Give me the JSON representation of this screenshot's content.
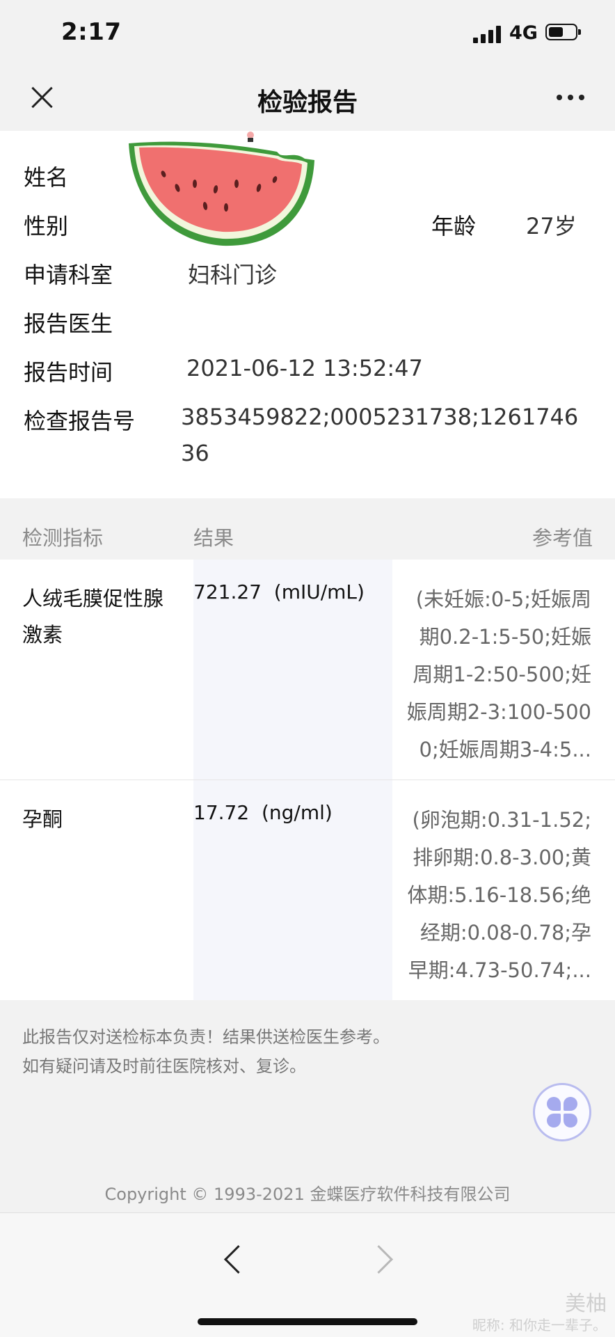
{
  "status_bar": {
    "time": "2:17",
    "network": "4G"
  },
  "nav": {
    "title": "检验报告"
  },
  "patient": {
    "name_label": "姓名",
    "gender_label": "性别",
    "age_label": "年龄",
    "age_value": "27岁",
    "department_label": "申请科室",
    "department_value": "妇科门诊",
    "doctor_label": "报告医生",
    "report_time_label": "报告时间",
    "report_time_value": "2021-06-12 13:52:47",
    "report_no_label": "检查报告号",
    "report_no_line1": "3853459822;0005231738;1261746",
    "report_no_line2": "36"
  },
  "table": {
    "headers": {
      "indicator": "检测指标",
      "result": "结果",
      "reference": "参考值"
    },
    "rows": [
      {
        "name": "人绒毛膜促性腺激素",
        "result": "721.27  (mIU/mL)",
        "reference": "(未妊娠:0-5;妊娠周期0.2-1:5-50;妊娠周期1-2:50-500;妊娠周期2-3:100-5000;妊娠周期3-4:5..."
      },
      {
        "name": "孕酮",
        "result": "17.72  (ng/ml)",
        "reference": "(卵泡期:0.31-1.52;排卵期:0.8-3.00;黄体期:5.16-18.56;绝经期:0.08-0.78;孕早期:4.73-50.74;..."
      }
    ]
  },
  "footer": {
    "note_line1": "此报告仅对送检标本负责！结果供送检医生参考。",
    "note_line2": "如有疑问请及时前往医院核对、复诊。",
    "copyright": "Copyright © 1993-2021 金蝶医疗软件科技有限公司"
  },
  "watermark": {
    "brand": "美柚",
    "nickname": "昵称: 和你走一辈子。"
  },
  "icons": {
    "close": "close-icon",
    "more": "more-icon",
    "menu": "clover-menu-icon",
    "back": "chevron-left-icon",
    "forward": "chevron-right-icon"
  },
  "colors": {
    "accent": "#a5aaee",
    "result_column_bg": "#f5f6fb"
  }
}
